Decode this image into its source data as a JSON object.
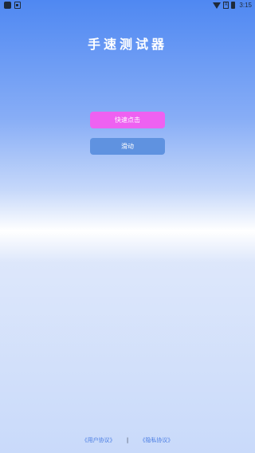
{
  "status_bar": {
    "time": "3:15",
    "sim_label": "R",
    "icons": [
      "app-icon",
      "notification-icon",
      "wifi-icon",
      "sim-icon",
      "battery-icon"
    ]
  },
  "title": "手速测试器",
  "buttons": {
    "fast_click": "快速点击",
    "swipe": "滑动"
  },
  "footer": {
    "user_agreement": "《用户协议》",
    "separator": "|",
    "privacy_policy": "《隐私协议》"
  },
  "colors": {
    "gradient_top": "#4f88f2",
    "fast_click_button": "#ee61f1",
    "swipe_button": "#5f92e0",
    "link": "#4a7de3"
  }
}
